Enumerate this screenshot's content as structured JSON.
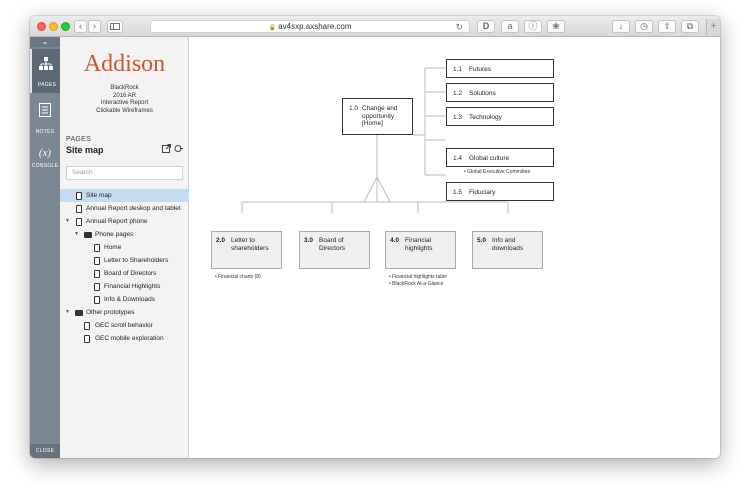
{
  "browser": {
    "url": "av4sxp.axshare.com",
    "back": "‹",
    "forward": "›"
  },
  "rail": {
    "pages_label": "PAGES",
    "notes_label": "NOTES",
    "console_label": "CONSOLE",
    "console_glyph": "(x)",
    "close_label": "CLOSE"
  },
  "panel": {
    "brand": "Addison",
    "project_lines": [
      "BlackRock",
      "2016 AR",
      "Interactive Report",
      "Clickable Wireframes"
    ],
    "pages_label": "PAGES",
    "title": "Site map",
    "search_placeholder": "Search",
    "tree": [
      {
        "label": "Site map",
        "type": "page",
        "level": 0,
        "selected": true
      },
      {
        "label": "Annual Report deskop and tablet",
        "type": "page",
        "level": 0
      },
      {
        "label": "Annual Report phone",
        "type": "page",
        "level": 0,
        "expanded": true
      },
      {
        "label": "Phone pages",
        "type": "folder",
        "level": 1,
        "expanded": true
      },
      {
        "label": "Home",
        "type": "page",
        "level": 2
      },
      {
        "label": "Letter to Shareholders",
        "type": "page",
        "level": 2
      },
      {
        "label": "Board of Directors",
        "type": "page",
        "level": 2
      },
      {
        "label": "Financial Highlights",
        "type": "page",
        "level": 2
      },
      {
        "label": "Info & Downloads",
        "type": "page",
        "level": 2
      },
      {
        "label": "Other prototypes",
        "type": "folder",
        "level": 0,
        "expanded": true
      },
      {
        "label": "GEC scroll behavior",
        "type": "page",
        "level": 1
      },
      {
        "label": "GEC mobile exploration",
        "type": "page",
        "level": 1
      }
    ]
  },
  "sitemap": {
    "home": {
      "num": "1.0",
      "lines": [
        "Change and",
        "opportunity",
        "[Home]"
      ]
    },
    "right_nodes": [
      {
        "num": "1.1",
        "label": "Futures"
      },
      {
        "num": "1.2",
        "label": "Solutions"
      },
      {
        "num": "1.3",
        "label": "Technology"
      },
      {
        "num": "1.4",
        "label": "Global culture",
        "note": "• Global Executive Committee"
      },
      {
        "num": "1.5",
        "label": "Fiduciary"
      }
    ],
    "bottom_nodes": [
      {
        "num": "2.0",
        "lines": [
          "Letter to",
          "shareholders"
        ],
        "notes": [
          "• Financial charts (8)"
        ]
      },
      {
        "num": "3.0",
        "lines": [
          "Board of",
          "Directors"
        ],
        "notes": []
      },
      {
        "num": "4.0",
        "lines": [
          "Financial",
          "highlights"
        ],
        "notes": [
          "• Financial highlights table",
          "• BlackRock At-a-Glance"
        ]
      },
      {
        "num": "5.0",
        "lines": [
          "Info and",
          "downloads"
        ],
        "notes": []
      }
    ]
  }
}
